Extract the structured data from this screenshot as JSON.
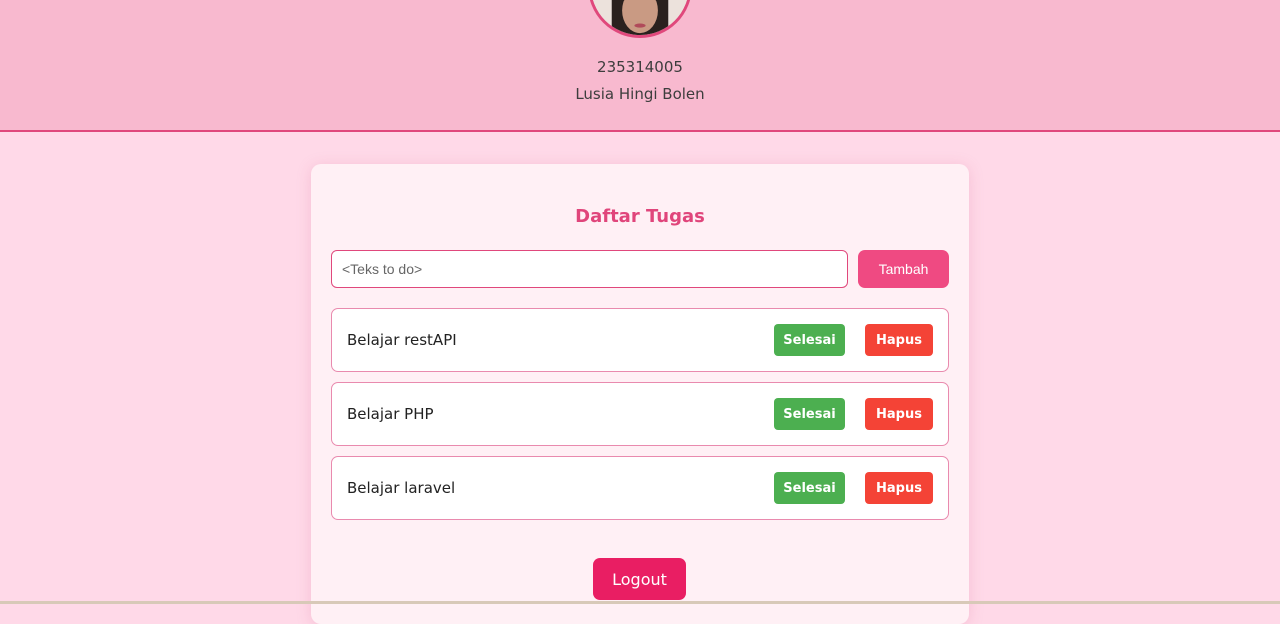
{
  "profile": {
    "nim": "235314005",
    "name": "Lusia Hingi Bolen"
  },
  "todo": {
    "title": "Daftar Tugas",
    "input_placeholder": "<Teks to do>",
    "input_value": "",
    "add_label": "Tambah",
    "done_label": "Selesai",
    "delete_label": "Hapus",
    "tasks": [
      {
        "text": "Belajar restAPI"
      },
      {
        "text": "Belajar PHP"
      },
      {
        "text": "Belajar laravel"
      }
    ],
    "logout_label": "Logout"
  },
  "colors": {
    "header_bg": "#f8b9cf",
    "page_bg": "#ffd9e8",
    "accent": "#e0487c",
    "done": "#4caf50",
    "delete": "#f44336",
    "logout": "#e91e63"
  }
}
